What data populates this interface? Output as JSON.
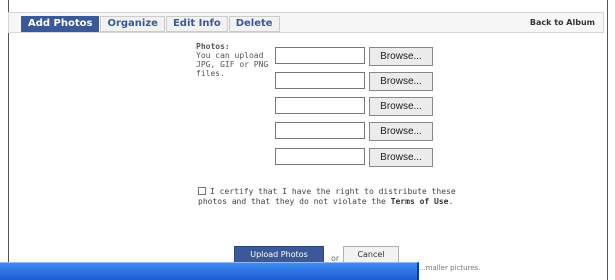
{
  "tabs": [
    {
      "label": "Add Photos",
      "active": true
    },
    {
      "label": "Organize",
      "active": false
    },
    {
      "label": "Edit Info",
      "active": false
    },
    {
      "label": "Delete",
      "active": false
    }
  ],
  "back_link": "Back to Album",
  "upload": {
    "photos_label": "Photos:",
    "help_text": "You can upload JPG, GIF or PNG files.",
    "inputs": [
      "",
      "",
      "",
      "",
      ""
    ],
    "browse_label": "Browse..."
  },
  "certify": {
    "checked": false,
    "text": "I certify that I have the right to distribute these photos and that they do not violate the",
    "terms_link": "Terms of Use",
    "end": "."
  },
  "actions": {
    "upload_label": "Upload Photos",
    "or_text": "or",
    "cancel_label": "Cancel"
  },
  "note": "...maller pictures.",
  "colors": {
    "accent": "#3b5998",
    "titlebar": "#2563de"
  }
}
